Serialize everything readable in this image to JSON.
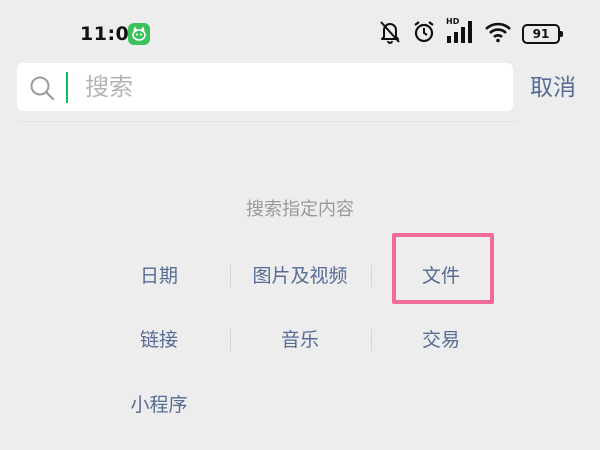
{
  "status_bar": {
    "time": "11:01",
    "network_label": "HD",
    "battery_level": "91",
    "icons": [
      "app-badge-icon",
      "mute-bell-icon",
      "alarm-clock-icon",
      "signal-icon",
      "wifi-icon",
      "battery-icon"
    ]
  },
  "search": {
    "placeholder": "搜索",
    "value": "",
    "cancel_label": "取消"
  },
  "section": {
    "title": "搜索指定内容",
    "options": [
      {
        "label": "日期"
      },
      {
        "label": "图片及视频"
      },
      {
        "label": "文件"
      },
      {
        "label": "链接"
      },
      {
        "label": "音乐"
      },
      {
        "label": "交易"
      },
      {
        "label": "小程序"
      }
    ]
  },
  "colors": {
    "background": "#ededed",
    "link": "#576b95",
    "cursor": "#07c160",
    "highlight": "#f06b9a",
    "badge": "#3cc25a"
  }
}
